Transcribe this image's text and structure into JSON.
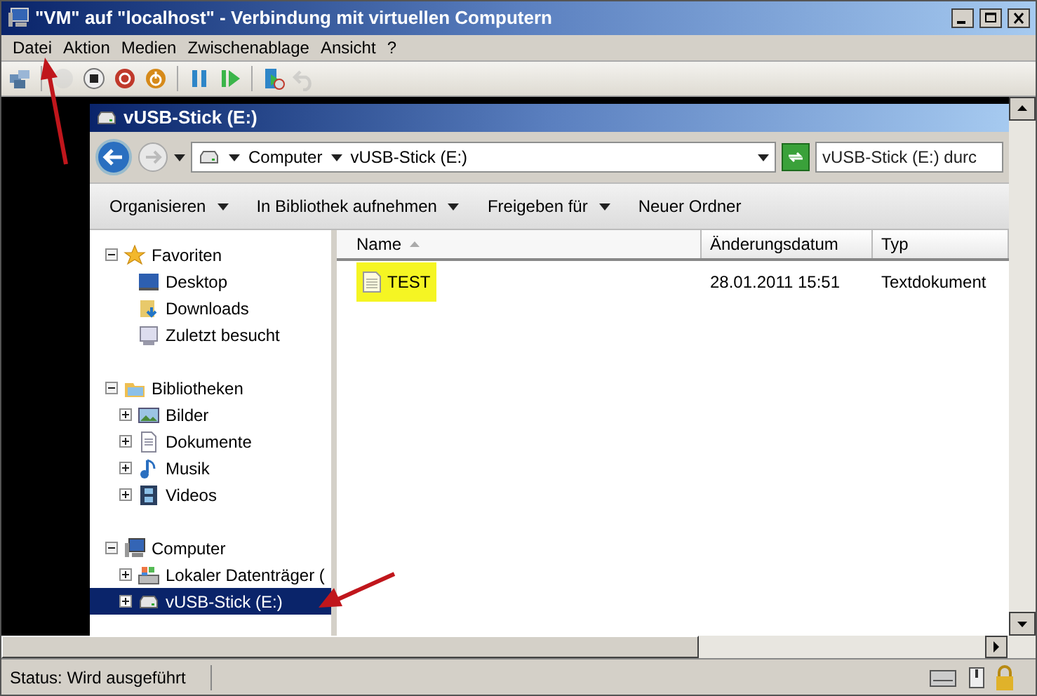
{
  "window": {
    "title": "\"VM\" auf \"localhost\" - Verbindung mit virtuellen Computern"
  },
  "menu": [
    "Datei",
    "Aktion",
    "Medien",
    "Zwischenablage",
    "Ansicht",
    "?"
  ],
  "toolbar": [
    {
      "kind": "ctrl-alt-del",
      "disabled": false
    },
    {
      "kind": "start",
      "disabled": true
    },
    {
      "kind": "stop",
      "disabled": false
    },
    {
      "kind": "shutdown",
      "disabled": false
    },
    {
      "kind": "power",
      "disabled": false
    },
    {
      "kind": "pause",
      "disabled": false
    },
    {
      "kind": "resume",
      "disabled": false
    },
    {
      "kind": "snapshot",
      "disabled": false
    },
    {
      "kind": "revert",
      "disabled": true
    }
  ],
  "explorer": {
    "title": "vUSB-Stick (E:)",
    "breadcrumb": [
      "Computer",
      "vUSB-Stick (E:)"
    ],
    "search": {
      "placeholder": "vUSB-Stick (E:) durc"
    },
    "commands": [
      {
        "label": "Organisieren",
        "dropdown": true
      },
      {
        "label": "In Bibliothek aufnehmen",
        "dropdown": true
      },
      {
        "label": "Freigeben für",
        "dropdown": true
      },
      {
        "label": "Neuer Ordner",
        "dropdown": false
      }
    ],
    "tree": [
      {
        "label": "Favoriten",
        "kind": "star",
        "expanded": true,
        "selected": false,
        "children": [
          {
            "label": "Desktop",
            "kind": "desktop",
            "selected": false
          },
          {
            "label": "Downloads",
            "kind": "downloads",
            "selected": false
          },
          {
            "label": "Zuletzt besucht",
            "kind": "recent",
            "selected": false
          }
        ]
      },
      {
        "label": "Bibliotheken",
        "kind": "library",
        "expanded": true,
        "selected": false,
        "children": [
          {
            "label": "Bilder",
            "kind": "pictures",
            "expanded": false,
            "selected": false
          },
          {
            "label": "Dokumente",
            "kind": "documents",
            "expanded": false,
            "selected": false
          },
          {
            "label": "Musik",
            "kind": "music",
            "expanded": false,
            "selected": false
          },
          {
            "label": "Videos",
            "kind": "videos",
            "expanded": false,
            "selected": false
          }
        ]
      },
      {
        "label": "Computer",
        "kind": "computer",
        "expanded": true,
        "selected": false,
        "children": [
          {
            "label": "Lokaler Datenträger (",
            "kind": "disk",
            "expanded": false,
            "selected": false
          },
          {
            "label": "vUSB-Stick (E:)",
            "kind": "usb",
            "expanded": false,
            "selected": true
          }
        ]
      }
    ],
    "columns": [
      {
        "label": "Name",
        "sorted": true
      },
      {
        "label": "Änderungsdatum",
        "sorted": false
      },
      {
        "label": "Typ",
        "sorted": false
      }
    ],
    "rows": [
      {
        "name": "TEST",
        "date": "28.01.2011 15:51",
        "type": "Textdokument",
        "highlighted": true
      }
    ]
  },
  "status_bar": {
    "text": "Status: Wird ausgeführt"
  }
}
